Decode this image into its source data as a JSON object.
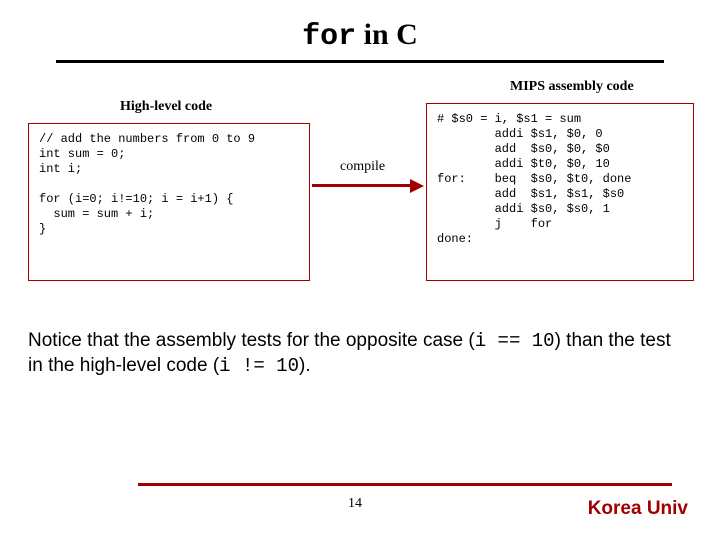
{
  "title": {
    "keyword": "for",
    "rest": " in C"
  },
  "labels": {
    "left": "High-level code",
    "right": "MIPS assembly code",
    "compile": "compile"
  },
  "code": {
    "c": "// add the numbers from 0 to 9\nint sum = 0;\nint i;\n\nfor (i=0; i!=10; i = i+1) {\n  sum = sum + i;\n}",
    "mips": "# $s0 = i, $s1 = sum\n        addi $s1, $0, 0\n        add  $s0, $0, $0\n        addi $t0, $0, 10\nfor:    beq  $s0, $t0, done\n        add  $s1, $s1, $s0\n        addi $s0, $s0, 1\n        j    for\ndone:"
  },
  "notice": {
    "p1": "Notice that the assembly tests for the opposite case (",
    "c1": "i == 10",
    "p2": ") than the test in the high-level code (",
    "c2": "i != 10",
    "p3": ")."
  },
  "footer": {
    "page": "14",
    "univ": "Korea Univ"
  }
}
